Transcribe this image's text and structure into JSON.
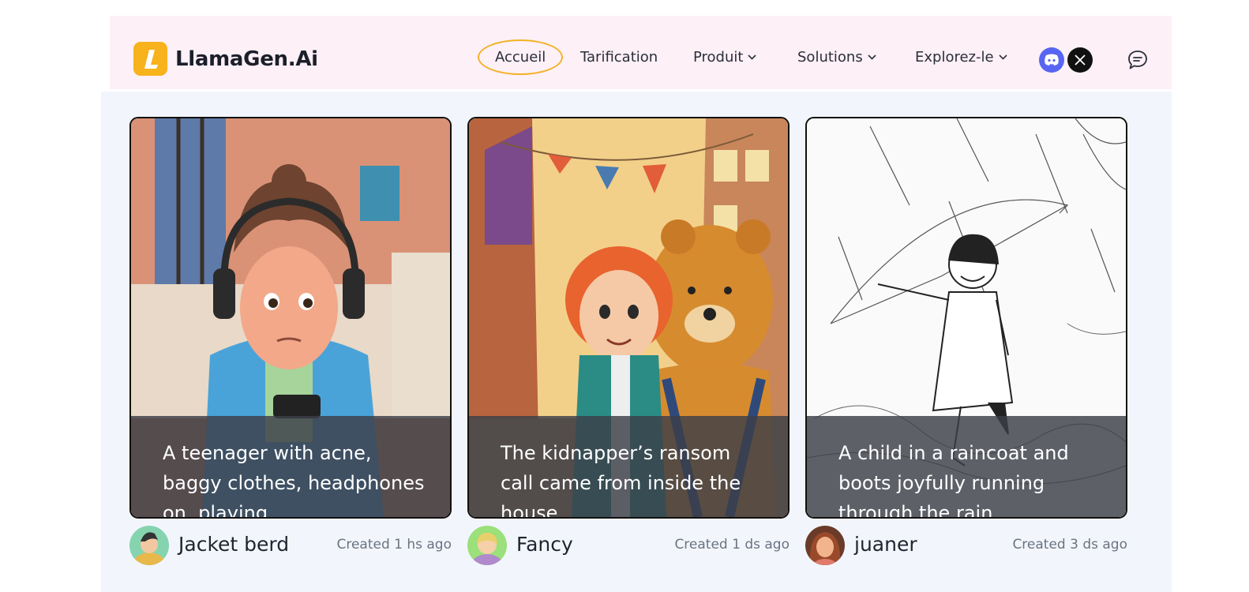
{
  "brand": {
    "name": "LlamaGen.Ai",
    "mark": "L"
  },
  "nav": {
    "home": "Accueil",
    "pricing": "Tarification",
    "product": "Produit",
    "solutions": "Solutions",
    "explore": "Explorez-le"
  },
  "icons": [
    "discord-icon",
    "x-icon",
    "chat-icon",
    "chevron-down-icon"
  ],
  "colors": {
    "accent": "#f7b21c",
    "header_bg": "#fdf0f7",
    "panel_bg": "#f2f6fc",
    "discord": "#5865f2"
  },
  "cards": [
    {
      "caption": "A teenager with acne, baggy clothes, headphones on, playing",
      "author": "Jacket berd",
      "created": "Created 1 hs ago"
    },
    {
      "caption": "The kidnapper’s ransom call came from inside the house",
      "author": "Fancy",
      "created": "Created 1 ds ago"
    },
    {
      "caption": "A child in a raincoat and boots joyfully running through the rain",
      "author": "juaner",
      "created": "Created 3 ds ago"
    }
  ]
}
